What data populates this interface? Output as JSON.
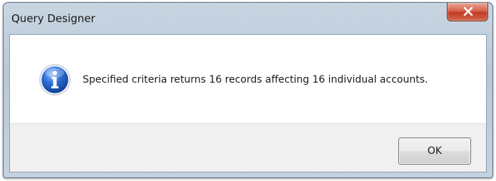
{
  "window": {
    "title": "Query Designer"
  },
  "message": {
    "text": "Specified criteria returns 16 records affecting 16 individual accounts.",
    "icon": "info-icon"
  },
  "buttons": {
    "ok_label": "OK"
  },
  "colors": {
    "titlebar": "#c4d1de",
    "close_button": "#d2694d",
    "info_icon": "#2a62c6"
  }
}
